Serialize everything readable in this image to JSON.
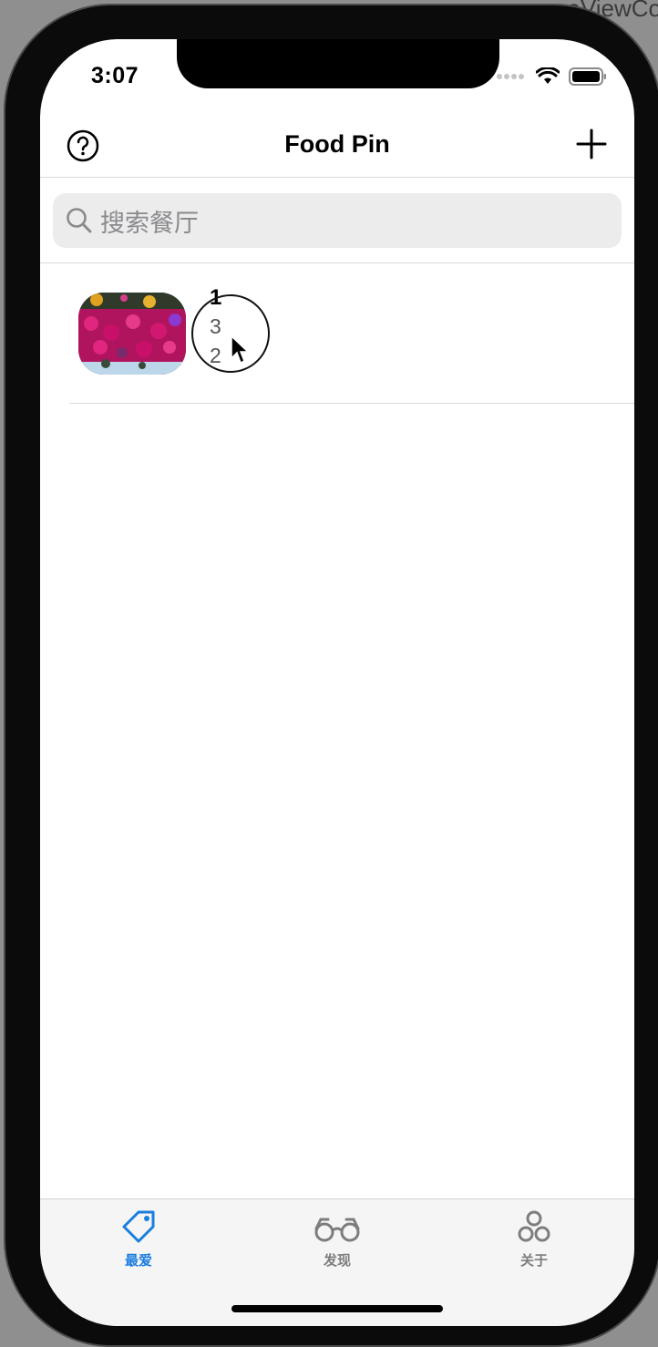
{
  "backdrop": {
    "partial_text": "eViewCo"
  },
  "status_bar": {
    "time": "3:07"
  },
  "nav": {
    "title": "Food Pin",
    "help_icon": "question-circle-icon",
    "add_icon": "plus-icon"
  },
  "search": {
    "placeholder": "搜索餐厅"
  },
  "restaurants": [
    {
      "name": "1",
      "line1": "3",
      "line2": "2",
      "image": "flowers-thumbnail"
    }
  ],
  "tabs": [
    {
      "label": "最爱",
      "icon": "tag-icon",
      "active": true
    },
    {
      "label": "发现",
      "icon": "glasses-icon",
      "active": false
    },
    {
      "label": "关于",
      "icon": "three-circles-icon",
      "active": false
    }
  ],
  "colors": {
    "accent": "#1a7ddf",
    "inactive": "#7d7d7d",
    "search_bg": "#ececec"
  }
}
